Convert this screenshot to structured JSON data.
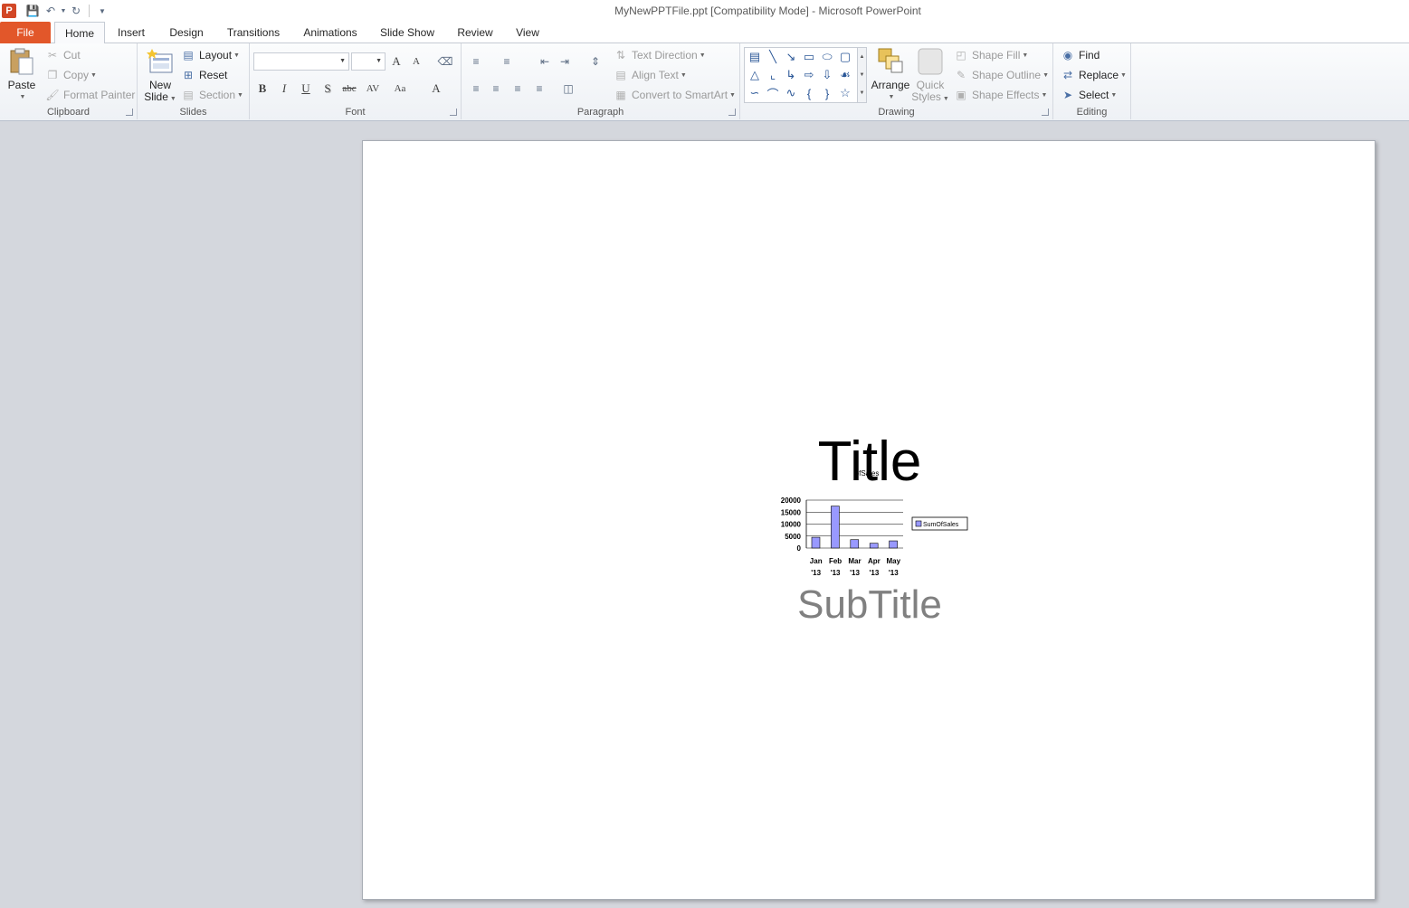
{
  "window": {
    "title": "MyNewPPTFile.ppt [Compatibility Mode]  -  Microsoft PowerPoint",
    "app_logo": "P"
  },
  "tabs": [
    {
      "label": "File"
    },
    {
      "label": "Home"
    },
    {
      "label": "Insert"
    },
    {
      "label": "Design"
    },
    {
      "label": "Transitions"
    },
    {
      "label": "Animations"
    },
    {
      "label": "Slide Show"
    },
    {
      "label": "Review"
    },
    {
      "label": "View"
    }
  ],
  "ribbon": {
    "clipboard": {
      "label": "Clipboard",
      "paste": "Paste",
      "cut": "Cut",
      "copy": "Copy",
      "format_painter": "Format Painter"
    },
    "slides": {
      "label": "Slides",
      "new_slide_1": "New",
      "new_slide_2": "Slide",
      "layout": "Layout",
      "reset": "Reset",
      "section": "Section"
    },
    "font": {
      "label": "Font",
      "grow": "A",
      "shrink": "A",
      "bold": "B",
      "italic": "I",
      "underline": "U",
      "shadow": "S",
      "strike": "abc",
      "spacing": "AV",
      "case": "Aa",
      "color": "A"
    },
    "paragraph": {
      "label": "Paragraph",
      "text_direction": "Text Direction",
      "align_text": "Align Text",
      "convert_smartart": "Convert to SmartArt"
    },
    "drawing": {
      "label": "Drawing",
      "arrange": "Arrange",
      "quick_1": "Quick",
      "quick_2": "Styles",
      "shape_fill": "Shape Fill",
      "shape_outline": "Shape Outline",
      "shape_effects": "Shape Effects"
    },
    "editing": {
      "label": "Editing",
      "find": "Find",
      "replace": "Replace",
      "select": "Select"
    }
  },
  "slide": {
    "title": "Title",
    "subtitle": "SubTitle"
  },
  "chart_data": {
    "type": "bar",
    "title": "ofSales",
    "categories": [
      "Jan '13",
      "Feb '13",
      "Mar '13",
      "Apr '13",
      "May '13"
    ],
    "category_lines": [
      [
        "Jan",
        "'13"
      ],
      [
        "Feb",
        "'13"
      ],
      [
        "Mar",
        "'13"
      ],
      [
        "Apr",
        "'13"
      ],
      [
        "May",
        "'13"
      ]
    ],
    "series": [
      {
        "name": "SumOfSales",
        "values": [
          4500,
          17500,
          3500,
          2000,
          3000
        ],
        "color": "#9999ff"
      }
    ],
    "yticks": [
      0,
      5000,
      10000,
      15000,
      20000
    ],
    "ylim": [
      0,
      20000
    ],
    "grid": true,
    "legend": "right"
  }
}
